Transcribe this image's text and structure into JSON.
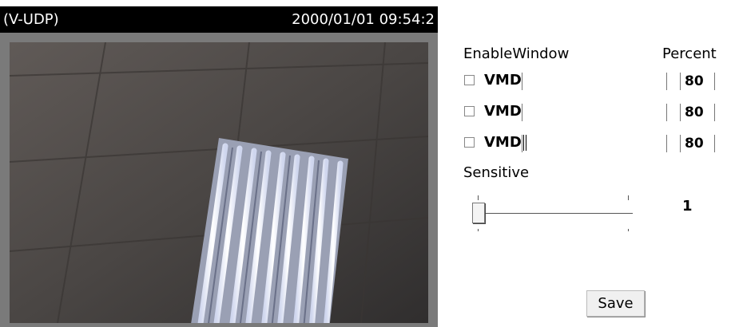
{
  "video": {
    "mode_label": "(V-UDP)",
    "timestamp": "2000/01/01 09:54:2"
  },
  "controls": {
    "enable_window_header": "EnableWindow",
    "percent_header": "Percent",
    "vmd_rows": [
      {
        "label": "VMD",
        "checked": false,
        "window_value": "",
        "percent": "80"
      },
      {
        "label": "VMD",
        "checked": false,
        "window_value": "",
        "percent": "80"
      },
      {
        "label": "VMD",
        "checked": false,
        "window_value": "",
        "percent": "80"
      }
    ],
    "sensitive_label": "Sensitive",
    "sensitive_value": "1",
    "save_label": "Save"
  }
}
